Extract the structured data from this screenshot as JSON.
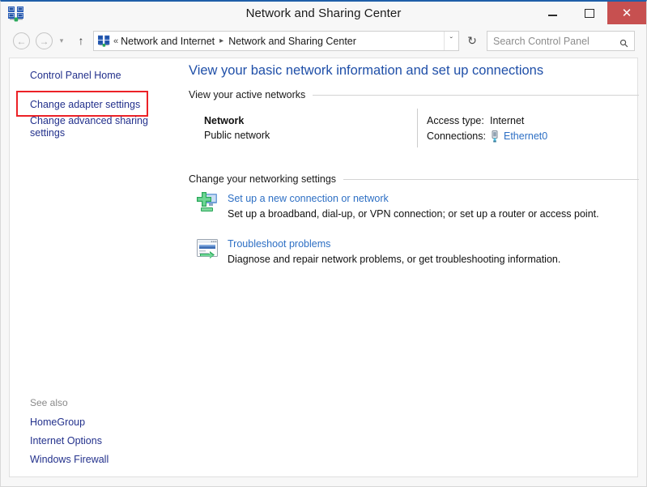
{
  "window": {
    "title": "Network and Sharing Center",
    "icon": "network-sharing-center-icon",
    "controls": {
      "minimize": "–",
      "maximize": "",
      "close": "✕"
    }
  },
  "addressbar": {
    "back_icon": "←",
    "forward_icon": "→",
    "history_icon": "▾",
    "up_icon": "↑",
    "breadcrumb_icon": "network-sharing-center-icon",
    "breadcrumb_prefix": "«",
    "breadcrumb": [
      "Network and Internet",
      "Network and Sharing Center"
    ],
    "breadcrumb_separator": "▸",
    "dropdown_icon": "ˇ",
    "refresh_icon": "↻",
    "search": {
      "placeholder": "Search Control Panel",
      "value": "",
      "icon": "search-icon",
      "icon_glyph": "⚲"
    }
  },
  "sidebar": {
    "items": [
      {
        "label": "Control Panel Home",
        "highlighted": false
      },
      {
        "label": "Change adapter settings",
        "highlighted": true
      },
      {
        "label": "Change advanced sharing settings",
        "highlighted": false
      }
    ],
    "see_also": {
      "title": "See also",
      "links": [
        "HomeGroup",
        "Internet Options",
        "Windows Firewall"
      ]
    }
  },
  "main": {
    "heading": "View your basic network information and set up connections",
    "sections": {
      "active_networks": {
        "title": "View your active networks",
        "network": {
          "name": "Network",
          "type": "Public network",
          "access_type_label": "Access type:",
          "access_type_value": "Internet",
          "connections_label": "Connections:",
          "connection_name": "Ethernet0",
          "connection_icon": "ethernet-adapter-icon"
        }
      },
      "networking_settings": {
        "title": "Change your networking settings",
        "tasks": [
          {
            "icon": "new-connection-icon",
            "link": "Set up a new connection or network",
            "description": "Set up a broadband, dial-up, or VPN connection; or set up a router or access point."
          },
          {
            "icon": "troubleshoot-icon",
            "link": "Troubleshoot problems",
            "description": "Diagnose and repair network problems, or get troubleshooting information."
          }
        ]
      }
    }
  },
  "annotation": {
    "type": "highlight-rectangle",
    "target": "Change adapter settings",
    "color": "#ec2227"
  },
  "colors": {
    "accent_blue": "#1f5fa9",
    "link_blue": "#2d6fc4",
    "sidebar_link": "#23318c",
    "heading_blue": "#1f4fa8",
    "close_red": "#c75050",
    "annotation_red": "#ec2227"
  }
}
